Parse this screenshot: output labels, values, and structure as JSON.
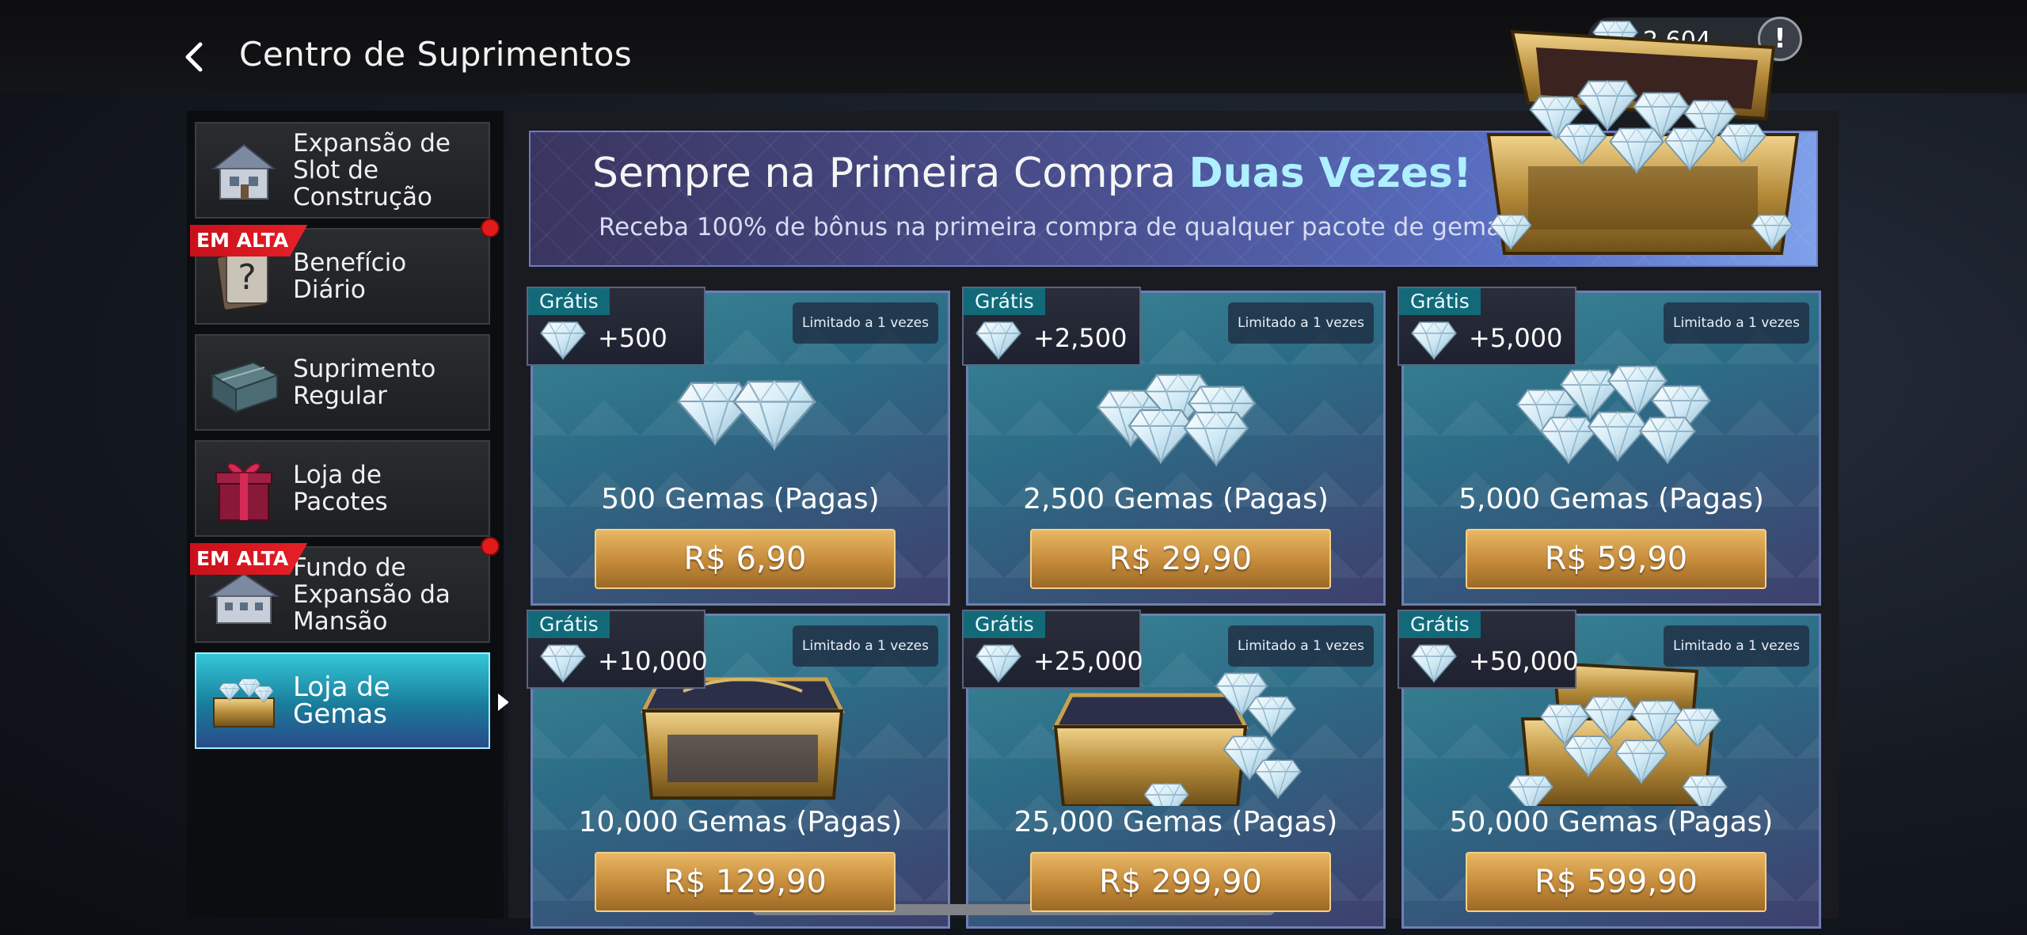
{
  "header": {
    "back_icon": "chevron-left-icon",
    "title": "Centro de Suprimentos",
    "currency_icon": "diamond-icon",
    "currency_value": "2,604",
    "info_icon": "exclamation-icon",
    "info_symbol": "!"
  },
  "sidebar": {
    "items": [
      {
        "label": "Expansão de\nSlot de\nConstrução",
        "icon": "house-icon",
        "badge": "",
        "dot": false,
        "active": false
      },
      {
        "label": "Benefício\nDiário",
        "icon": "mystery-card-icon",
        "badge": "EM ALTA",
        "dot": true,
        "active": false
      },
      {
        "label": "Suprimento\nRegular",
        "icon": "supply-crate-icon",
        "badge": "",
        "dot": false,
        "active": false
      },
      {
        "label": "Loja de\nPacotes",
        "icon": "gift-box-icon",
        "badge": "",
        "dot": false,
        "active": false
      },
      {
        "label": "Fundo de\nExpansão da\nMansão",
        "icon": "mansion-icon",
        "badge": "EM ALTA",
        "dot": true,
        "active": false
      },
      {
        "label": "Loja de Gemas",
        "icon": "gem-chest-icon",
        "badge": "",
        "dot": false,
        "active": true
      }
    ]
  },
  "banner": {
    "title_plain": "Sempre na Primeira Compra ",
    "title_highlight": "Duas Vezes!",
    "subtitle": "Receba 100% de bônus na primeira compra de qualquer pacote de gemas.",
    "art_icon": "treasure-chest-icon"
  },
  "offers": [
    {
      "free_label": "Grátis",
      "bonus": "+500",
      "limit": "Limitado a 1 vezes",
      "name": "500 Gemas (Pagas)",
      "price": "R$ 6,90",
      "art": "gems-small-icon"
    },
    {
      "free_label": "Grátis",
      "bonus": "+2,500",
      "limit": "Limitado a 1 vezes",
      "name": "2,500 Gemas (Pagas)",
      "price": "R$ 29,90",
      "art": "gems-pile-icon"
    },
    {
      "free_label": "Grátis",
      "bonus": "+5,000",
      "limit": "Limitado a 1 vezes",
      "name": "5,000 Gemas (Pagas)",
      "price": "R$ 59,90",
      "art": "gems-heap-icon"
    },
    {
      "free_label": "Grátis",
      "bonus": "+10,000",
      "limit": "Limitado a 1 vezes",
      "name": "10,000 Gemas (Pagas)",
      "price": "R$ 129,90",
      "art": "closed-chest-icon"
    },
    {
      "free_label": "Grátis",
      "bonus": "+25,000",
      "limit": "Limitado a 1 vezes",
      "name": "25,000 Gemas (Pagas)",
      "price": "R$ 299,90",
      "art": "chest-with-gems-icon"
    },
    {
      "free_label": "Grátis",
      "bonus": "+50,000",
      "limit": "Limitado a 1 vezes",
      "name": "50,000 Gemas (Pagas)",
      "price": "R$ 599,90",
      "art": "open-chest-gems-icon"
    }
  ],
  "colors": {
    "price_button": "#c48a3a",
    "hot_badge": "#e11a1a",
    "free_label": "#126a79",
    "active_tab": "#34c7d9"
  }
}
